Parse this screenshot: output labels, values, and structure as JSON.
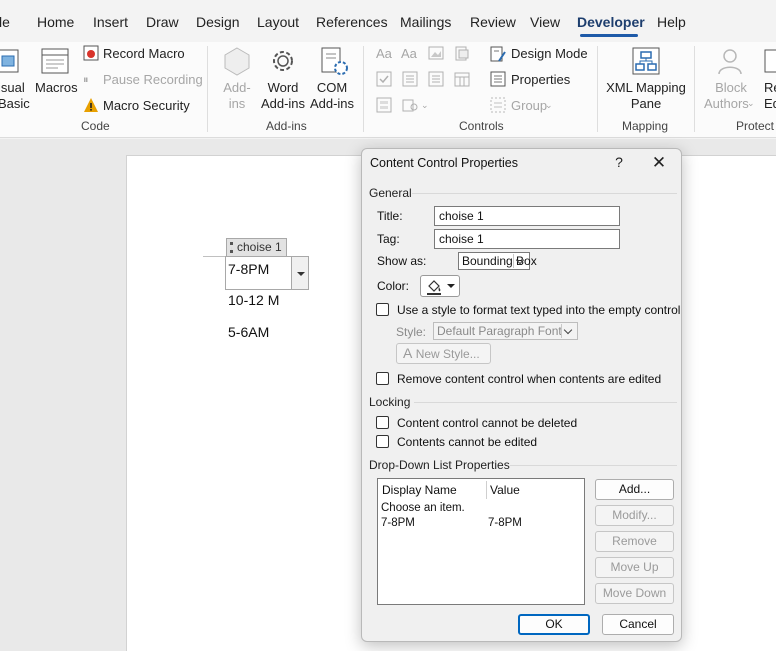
{
  "menu": {
    "file_partial": "le",
    "items": [
      "Home",
      "Insert",
      "Draw",
      "Design",
      "Layout",
      "References",
      "Mailings",
      "Review",
      "View",
      "Developer",
      "Help"
    ]
  },
  "ribbon": {
    "code": {
      "visual_basic_1": "isual",
      "visual_basic_2": "Basic",
      "macros": "Macros",
      "record_macro": "Record Macro",
      "pause_recording": "Pause Recording",
      "macro_security": "Macro Security",
      "label": "Code"
    },
    "addins": {
      "addins_1": "Add-",
      "addins_2": "ins",
      "word_1": "Word",
      "word_2": "Add-ins",
      "com_1": "COM",
      "com_2": "Add-ins",
      "label": "Add-ins"
    },
    "controls": {
      "design_mode": "Design Mode",
      "properties": "Properties",
      "group": "Group",
      "label": "Controls"
    },
    "mapping": {
      "xml_1": "XML Mapping",
      "xml_2": "Pane",
      "label": "Mapping"
    },
    "protect": {
      "block_1": "Block",
      "block_2": "Authors",
      "restrict_1": "Re",
      "restrict_2": "Ed",
      "label": "Protect"
    }
  },
  "document": {
    "cc_title": "choise 1",
    "cc_value": "7-8PM",
    "lines": [
      "10-12 M",
      "5-6AM"
    ]
  },
  "dialog": {
    "title": "Content Control Properties",
    "help": "?",
    "close": "✕",
    "general": "General",
    "title_label": "Title:",
    "title_value": "choise 1",
    "tag_label": "Tag:",
    "tag_value": "choise 1",
    "show_as_label": "Show as:",
    "show_as_value": "Bounding Box",
    "color_label": "Color:",
    "use_style": "Use a style to format text typed into the empty control",
    "style_label": "Style:",
    "style_value": "Default Paragraph Font",
    "new_style": "New Style...",
    "remove_cc": "Remove content control when contents are edited",
    "locking": "Locking",
    "cannot_delete": "Content control cannot be deleted",
    "cannot_edit": "Contents cannot be edited",
    "ddl_props": "Drop-Down List Properties",
    "col_display": "Display Name",
    "col_value": "Value",
    "rows": [
      {
        "display": "Choose an item.",
        "value": ""
      },
      {
        "display": "7-8PM",
        "value": "7-8PM"
      }
    ],
    "add": "Add...",
    "modify": "Modify...",
    "remove": "Remove",
    "move_up": "Move Up",
    "move_down": "Move Down",
    "ok": "OK",
    "cancel": "Cancel"
  },
  "colors": {
    "accent": "#1e5aa8",
    "warning": "#e8a000",
    "ok_border": "#0067c0"
  }
}
